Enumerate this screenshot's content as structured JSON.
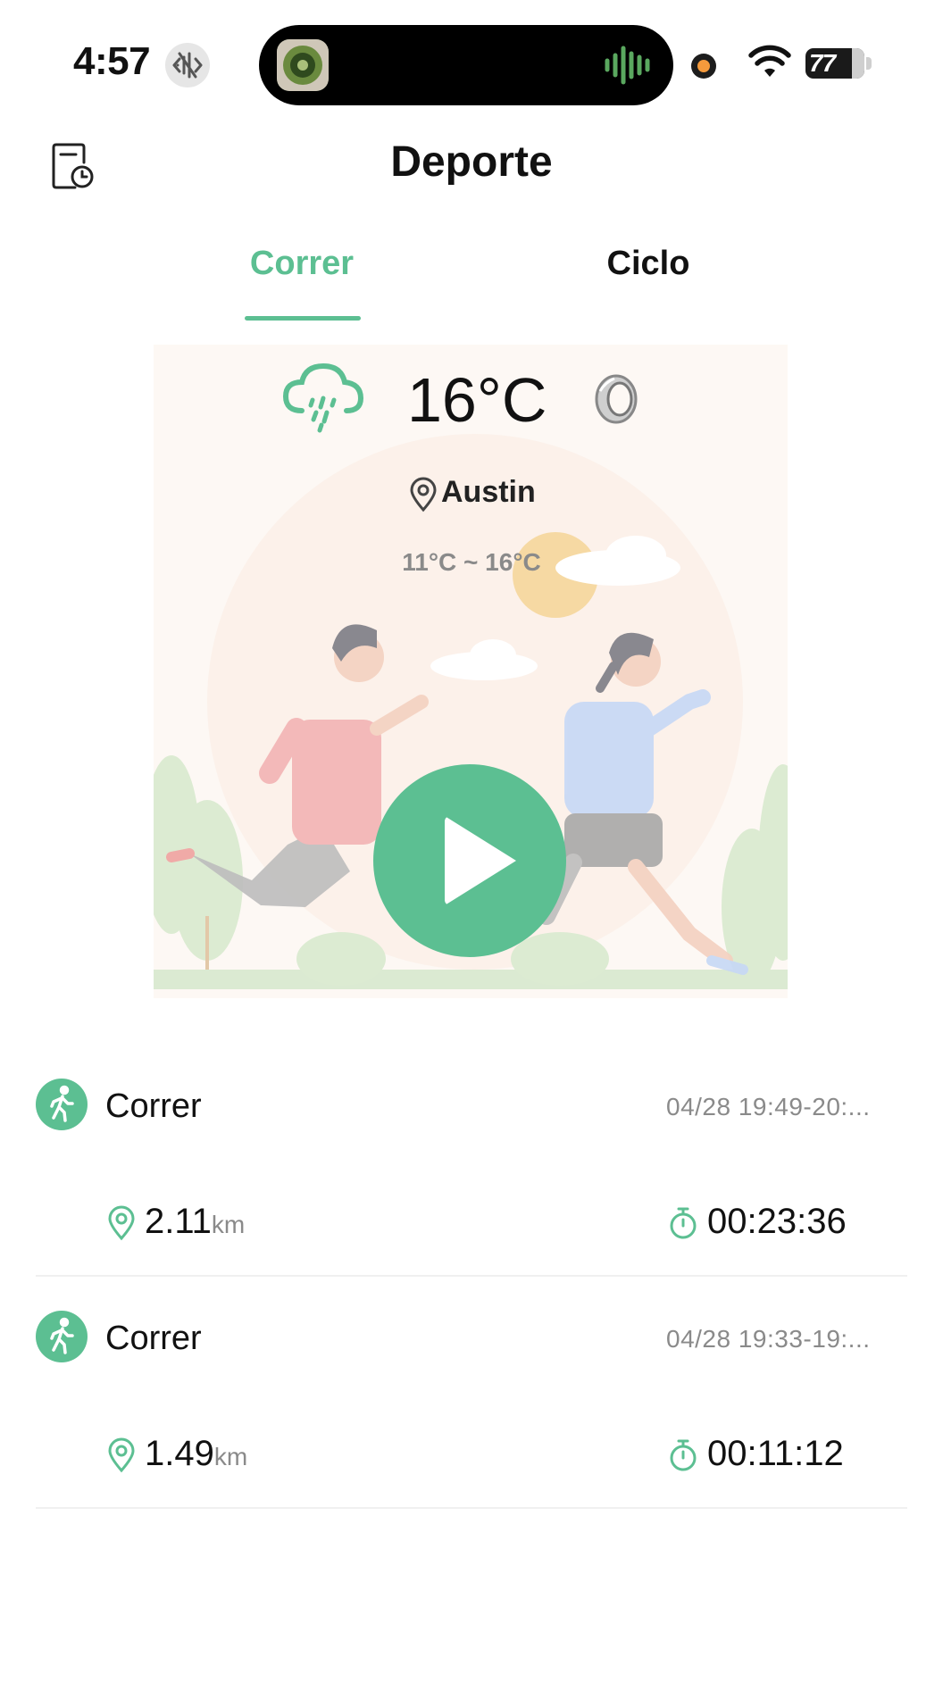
{
  "status_bar": {
    "time": "4:57",
    "battery": "77",
    "icons": [
      "mute-icon",
      "sound-wave-icon",
      "recording-dot-icon",
      "wifi-icon",
      "battery-icon"
    ]
  },
  "header": {
    "title": "Deporte",
    "left_icon": "history-icon"
  },
  "tabs": [
    {
      "label": "Correr",
      "active": true
    },
    {
      "label": "Ciclo",
      "active": false
    }
  ],
  "weather": {
    "temperature": "16°C",
    "icon": "rain-cloud-icon",
    "device_icon": "smart-ring-icon",
    "location": "Austin",
    "range": "11°C ~ 16°C"
  },
  "activities": [
    {
      "name": "Correr",
      "date": "04/28 19:49-20:...",
      "distance": "2.11",
      "unit": "km",
      "duration": "00:23:36"
    },
    {
      "name": "Correr",
      "date": "04/28 19:33-19:...",
      "distance": "1.49",
      "unit": "km",
      "duration": "00:11:12"
    }
  ],
  "colors": {
    "accent": "#5cbf92",
    "card_background": "#fdf8f4"
  }
}
